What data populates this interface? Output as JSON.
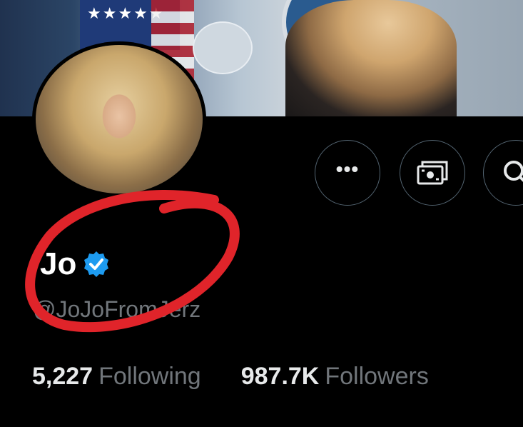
{
  "profile": {
    "display_name": "Jo",
    "handle": "@JoJoFromJerz",
    "verified": true
  },
  "stats": {
    "following_count": "5,227",
    "following_label": "Following",
    "followers_count": "987.7K",
    "followers_label": "Followers"
  },
  "actions": {
    "more_icon": "more-horizontal-icon",
    "tip_icon": "money-icon",
    "search_icon": "search-icon"
  },
  "colors": {
    "background": "#000000",
    "verified_badge": "#1d9bf0",
    "secondary_text": "#71767b",
    "annotation_circle": "#e0242a"
  }
}
